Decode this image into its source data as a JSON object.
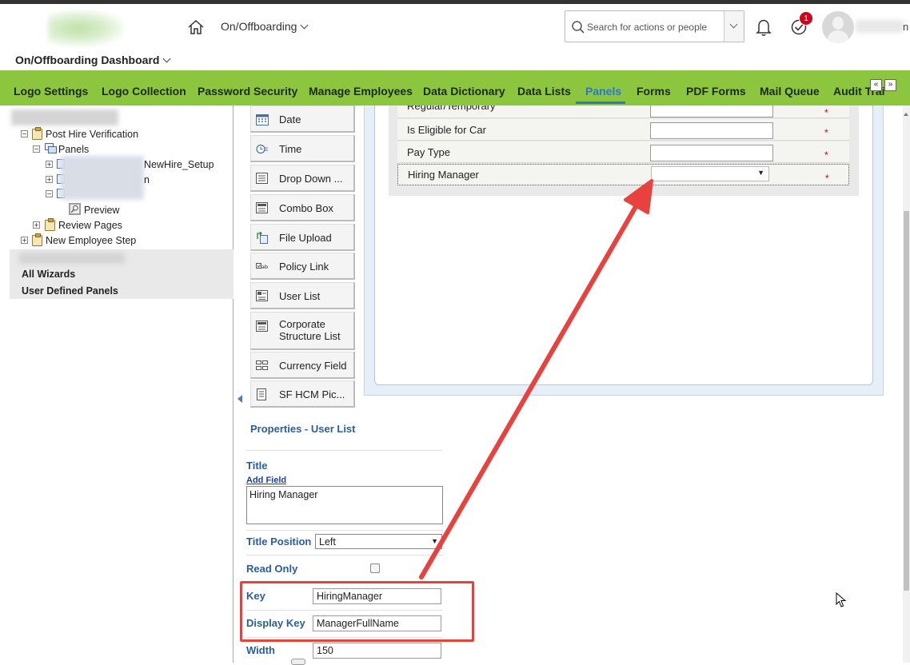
{
  "header": {
    "module_title": "On/Offboarding",
    "search_placeholder": "Search for actions or people",
    "notification_count": "1",
    "user_name_tail": "n",
    "dashboard_title": "On/Offboarding Dashboard"
  },
  "nav": {
    "items": [
      {
        "label": "Logo Settings"
      },
      {
        "label": "Logo Collection"
      },
      {
        "label": "Password Security"
      },
      {
        "label": "Manage Employees"
      },
      {
        "label": "Data Dictionary"
      },
      {
        "label": "Data Lists"
      },
      {
        "label": "Panels"
      },
      {
        "label": "Forms"
      },
      {
        "label": "PDF Forms"
      },
      {
        "label": "Mail Queue"
      },
      {
        "label": "Audit Trail"
      }
    ],
    "active": "Panels",
    "prev_label": "«",
    "next_label": "»"
  },
  "tree": {
    "post_hire": "Post Hire Verification",
    "panels": "Panels",
    "newhire_setup_tail": "NewHire_Setup",
    "second_tail": "n",
    "preview": "Preview",
    "review_pages": "Review Pages",
    "new_employee_step": "New Employee Step",
    "all_wizards": "All Wizards",
    "user_defined_panels": "User Defined Panels"
  },
  "palette": {
    "items": [
      {
        "label": "Date",
        "icon": "calendar-icon"
      },
      {
        "label": "Time",
        "icon": "clock-icon"
      },
      {
        "label": "Drop Down ...",
        "icon": "dropdown-icon"
      },
      {
        "label": "Combo Box",
        "icon": "combobox-icon"
      },
      {
        "label": "File Upload",
        "icon": "file-upload-icon"
      },
      {
        "label": "Policy Link",
        "icon": "policy-link-icon"
      },
      {
        "label": "User List",
        "icon": "user-list-icon"
      },
      {
        "label": "Corporate Structure List",
        "icon": "corporate-structure-icon"
      },
      {
        "label": "Currency Field",
        "icon": "currency-icon"
      },
      {
        "label": "SF HCM Pic...",
        "icon": "sf-hcm-picker-icon"
      }
    ]
  },
  "form": {
    "rows": [
      {
        "label": "Regular/Temporary",
        "required": "*"
      },
      {
        "label": "Is Eligible for Car",
        "required": "*"
      },
      {
        "label": "Pay Type",
        "required": "*"
      },
      {
        "label": "Hiring Manager",
        "required": "*"
      }
    ]
  },
  "properties": {
    "title": "Properties - User List",
    "title_label": "Title",
    "add_field": "Add Field",
    "title_value": "Hiring Manager",
    "title_position_label": "Title Position",
    "title_position_value": "Left",
    "read_only_label": "Read Only",
    "key_label": "Key",
    "key_value": "HiringManager",
    "display_key_label": "Display Key",
    "display_key_value": "ManagerFullName",
    "width_label": "Width",
    "width_value": "150"
  },
  "colors": {
    "nav_bg": "#8cc63f",
    "accent": "#2a78c8",
    "highlight": "#e8423f"
  }
}
